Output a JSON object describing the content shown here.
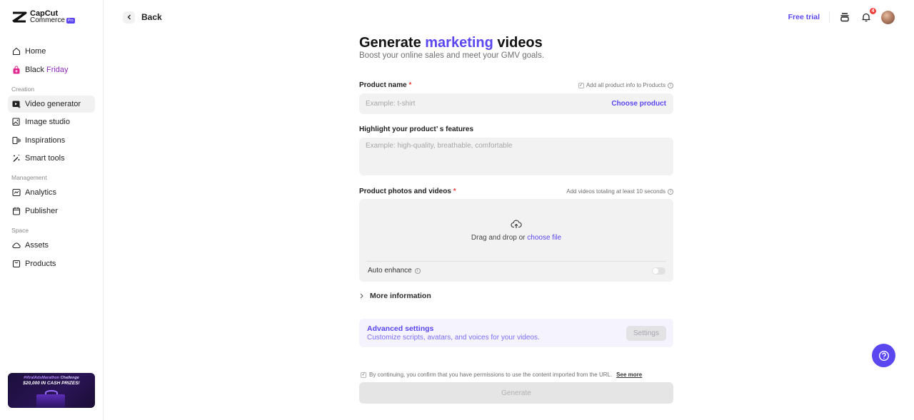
{
  "brand": {
    "line1": "CapCut",
    "line2": "Commerce",
    "badge": "Pro"
  },
  "sidebar": {
    "top_items": [
      {
        "label": "Home",
        "icon": "home-icon"
      },
      {
        "label_a": "Black ",
        "label_b": "Friday",
        "icon": "shopping-bag-icon"
      }
    ],
    "sections": [
      {
        "title": "Creation",
        "items": [
          {
            "label": "Video generator",
            "icon": "video-generator-icon",
            "active": true
          },
          {
            "label": "Image studio",
            "icon": "image-studio-icon"
          },
          {
            "label": "Inspirations",
            "icon": "inspirations-icon"
          },
          {
            "label": "Smart tools",
            "icon": "magic-wand-icon"
          }
        ]
      },
      {
        "title": "Management",
        "items": [
          {
            "label": "Analytics",
            "icon": "analytics-icon"
          },
          {
            "label": "Publisher",
            "icon": "calendar-icon"
          }
        ]
      },
      {
        "title": "Space",
        "items": [
          {
            "label": "Assets",
            "icon": "cloud-icon"
          },
          {
            "label": "Products",
            "icon": "product-box-icon"
          }
        ]
      }
    ],
    "promo": {
      "line1_a": "#ViralAdsMarathon",
      "line1_b": " Challenge",
      "line2": "$20,000 IN CASH PRIZES!"
    }
  },
  "topbar": {
    "back_label": "Back",
    "free_trial": "Free trial",
    "notification_count": "4"
  },
  "main": {
    "title_a": "Generate ",
    "title_accent": "marketing",
    "title_b": " videos",
    "subtitle": "Boost your online sales and meet your GMV goals.",
    "product_name": {
      "label": "Product name",
      "required": "*",
      "hint": "Add all product info to Products",
      "placeholder": "Example: t-shirt",
      "action": "Choose product"
    },
    "features": {
      "label": "Highlight your product’ s features",
      "placeholder": "Example: high-quality, breathable, comfortable"
    },
    "media": {
      "label": "Product photos and videos",
      "required": "*",
      "hint": "Add videos totaling at least 10 seconds",
      "drop_text": "Drag and drop or ",
      "drop_link": "choose file",
      "auto_enhance": "Auto enhance",
      "auto_enhance_on": false
    },
    "more_info": "More information",
    "advanced": {
      "title": "Advanced settings",
      "desc": "Customize scripts, avatars, and voices for your videos.",
      "button": "Settings"
    },
    "consent": {
      "text": "By continuing, you confirm that you have permissions to use the content imported from the URL.",
      "link": "See more",
      "checked": true
    },
    "generate": "Generate"
  },
  "colors": {
    "accent": "#5b47f0",
    "required": "#f0413d",
    "friday": "#8b2bb9"
  }
}
